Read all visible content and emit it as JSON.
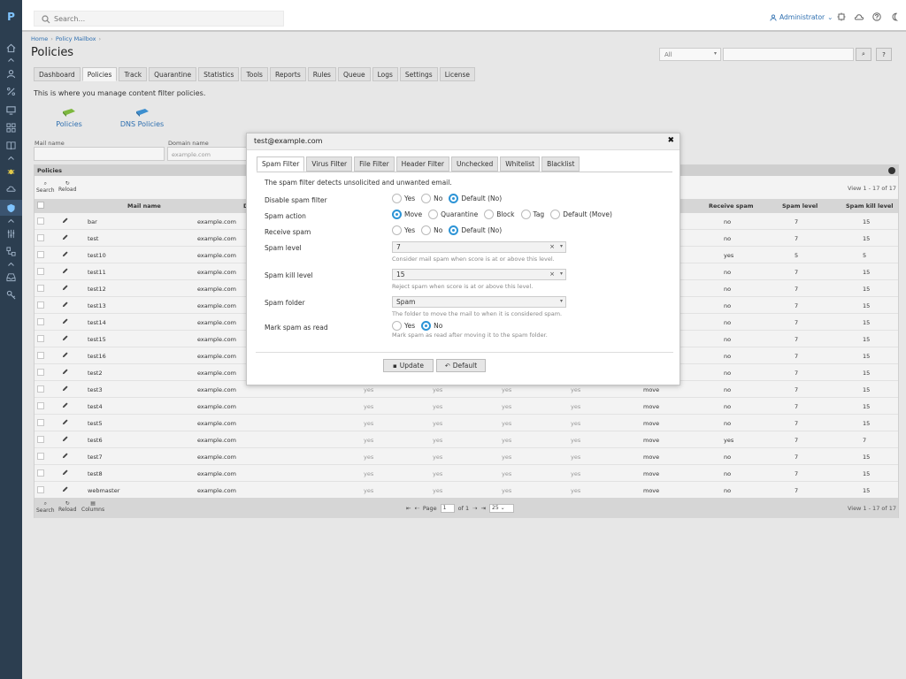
{
  "app": {
    "logo": "P"
  },
  "search": {
    "placeholder": "Search..."
  },
  "user": {
    "name": "Administrator",
    "caret": "⌄"
  },
  "breadcrumb": {
    "items": [
      "Home",
      "Policy Mailbox"
    ],
    "sep": "›"
  },
  "page": {
    "title": "Policies",
    "description": "This is where you manage content filter policies."
  },
  "filter": {
    "select_value": "All",
    "search_button": "⌕",
    "help_button": "?"
  },
  "nav_tabs": [
    "Dashboard",
    "Policies",
    "Track",
    "Quarantine",
    "Statistics",
    "Tools",
    "Reports",
    "Rules",
    "Queue",
    "Logs",
    "Settings",
    "License"
  ],
  "policy_icons": [
    {
      "label": "Policies"
    },
    {
      "label": "DNS Policies"
    }
  ],
  "search_form": {
    "mail_label": "Mail name",
    "domain_label": "Domain name",
    "domain_placeholder": "example.com"
  },
  "grid": {
    "title": "Policies",
    "tools_top": [
      "Search",
      "Reload"
    ],
    "tools_bottom": [
      "Search",
      "Reload",
      "Columns"
    ],
    "view": "View 1 - 17 of 17",
    "headers": {
      "mail": "Mail name",
      "domain": "D",
      "receive": "Receive spam",
      "level": "Spam level",
      "kill": "Spam kill level"
    },
    "rows": [
      {
        "mail": "bar",
        "domain": "example.com",
        "f1": "",
        "f2": "",
        "f3": "",
        "f4": "",
        "action": "",
        "receive": "no",
        "level": "7",
        "kill": "15"
      },
      {
        "mail": "test",
        "domain": "example.com",
        "f1": "",
        "f2": "",
        "f3": "",
        "f4": "",
        "action": "",
        "receive": "no",
        "level": "7",
        "kill": "15"
      },
      {
        "mail": "test10",
        "domain": "example.com",
        "f1": "",
        "f2": "",
        "f3": "",
        "f4": "",
        "action": "",
        "receive": "yes",
        "level": "5",
        "kill": "5"
      },
      {
        "mail": "test11",
        "domain": "example.com",
        "f1": "",
        "f2": "",
        "f3": "",
        "f4": "",
        "action": "",
        "receive": "no",
        "level": "7",
        "kill": "15"
      },
      {
        "mail": "test12",
        "domain": "example.com",
        "f1": "",
        "f2": "",
        "f3": "",
        "f4": "",
        "action": "",
        "receive": "no",
        "level": "7",
        "kill": "15"
      },
      {
        "mail": "test13",
        "domain": "example.com",
        "f1": "",
        "f2": "",
        "f3": "",
        "f4": "",
        "action": "",
        "receive": "no",
        "level": "7",
        "kill": "15"
      },
      {
        "mail": "test14",
        "domain": "example.com",
        "f1": "",
        "f2": "",
        "f3": "",
        "f4": "",
        "action": "",
        "receive": "no",
        "level": "7",
        "kill": "15"
      },
      {
        "mail": "test15",
        "domain": "example.com",
        "f1": "",
        "f2": "",
        "f3": "",
        "f4": "",
        "action": "",
        "receive": "no",
        "level": "7",
        "kill": "15"
      },
      {
        "mail": "test16",
        "domain": "example.com",
        "f1": "",
        "f2": "",
        "f3": "",
        "f4": "",
        "action": "",
        "receive": "no",
        "level": "7",
        "kill": "15"
      },
      {
        "mail": "test2",
        "domain": "example.com",
        "f1": "",
        "f2": "",
        "f3": "",
        "f4": "",
        "action": "",
        "receive": "no",
        "level": "7",
        "kill": "15"
      },
      {
        "mail": "test3",
        "domain": "example.com",
        "f1": "yes",
        "f2": "yes",
        "f3": "yes",
        "f4": "yes",
        "action": "move",
        "receive": "no",
        "level": "7",
        "kill": "15"
      },
      {
        "mail": "test4",
        "domain": "example.com",
        "f1": "yes",
        "f2": "yes",
        "f3": "yes",
        "f4": "yes",
        "action": "move",
        "receive": "no",
        "level": "7",
        "kill": "15"
      },
      {
        "mail": "test5",
        "domain": "example.com",
        "f1": "yes",
        "f2": "yes",
        "f3": "yes",
        "f4": "yes",
        "action": "move",
        "receive": "no",
        "level": "7",
        "kill": "15"
      },
      {
        "mail": "test6",
        "domain": "example.com",
        "f1": "yes",
        "f2": "yes",
        "f3": "yes",
        "f4": "yes",
        "action": "move",
        "receive": "yes",
        "level": "7",
        "kill": "7"
      },
      {
        "mail": "test7",
        "domain": "example.com",
        "f1": "yes",
        "f2": "yes",
        "f3": "yes",
        "f4": "yes",
        "action": "move",
        "receive": "no",
        "level": "7",
        "kill": "15"
      },
      {
        "mail": "test8",
        "domain": "example.com",
        "f1": "yes",
        "f2": "yes",
        "f3": "yes",
        "f4": "yes",
        "action": "move",
        "receive": "no",
        "level": "7",
        "kill": "15"
      },
      {
        "mail": "webmaster",
        "domain": "example.com",
        "f1": "yes",
        "f2": "yes",
        "f3": "yes",
        "f4": "yes",
        "action": "move",
        "receive": "no",
        "level": "7",
        "kill": "15"
      }
    ],
    "pager": {
      "first": "⇤",
      "prev": "⇠",
      "page_label": "Page",
      "page": "1",
      "of": "of 1",
      "next": "⇢",
      "last": "⇥",
      "page_size": "25 ⌄"
    }
  },
  "modal": {
    "title": "test@example.com",
    "close": "✖",
    "tabs": [
      "Spam Filter",
      "Virus Filter",
      "File Filter",
      "Header Filter",
      "Unchecked",
      "Whitelist",
      "Blacklist"
    ],
    "description": "The spam filter detects unsolicited and unwanted email.",
    "disable_spam_filter": {
      "label": "Disable spam filter",
      "options": [
        "Yes",
        "No",
        "Default (No)"
      ],
      "selected": 2
    },
    "spam_action": {
      "label": "Spam action",
      "options": [
        "Move",
        "Quarantine",
        "Block",
        "Tag",
        "Default (Move)"
      ],
      "selected": 0
    },
    "receive_spam": {
      "label": "Receive spam",
      "options": [
        "Yes",
        "No",
        "Default (No)"
      ],
      "selected": 2
    },
    "spam_level": {
      "label": "Spam level",
      "value": "7",
      "clear": "×",
      "arrow": "▾",
      "hint": "Consider mail spam when score is at or above this level."
    },
    "spam_kill_level": {
      "label": "Spam kill level",
      "value": "15",
      "clear": "×",
      "arrow": "▾",
      "hint": "Reject spam when score is at or above this level."
    },
    "spam_folder": {
      "label": "Spam folder",
      "value": "Spam",
      "arrow": "▾",
      "hint": "The folder to move the mail to when it is considered spam."
    },
    "mark_read": {
      "label": "Mark spam as read",
      "options": [
        "Yes",
        "No"
      ],
      "selected": 1,
      "hint": "Mark spam as read after moving it to the spam folder."
    },
    "update_label": "Update",
    "default_label": "Default"
  },
  "colors": {
    "sidebar": "#2c3e50",
    "accent": "#2d94d6",
    "link": "#2e6fb0"
  }
}
